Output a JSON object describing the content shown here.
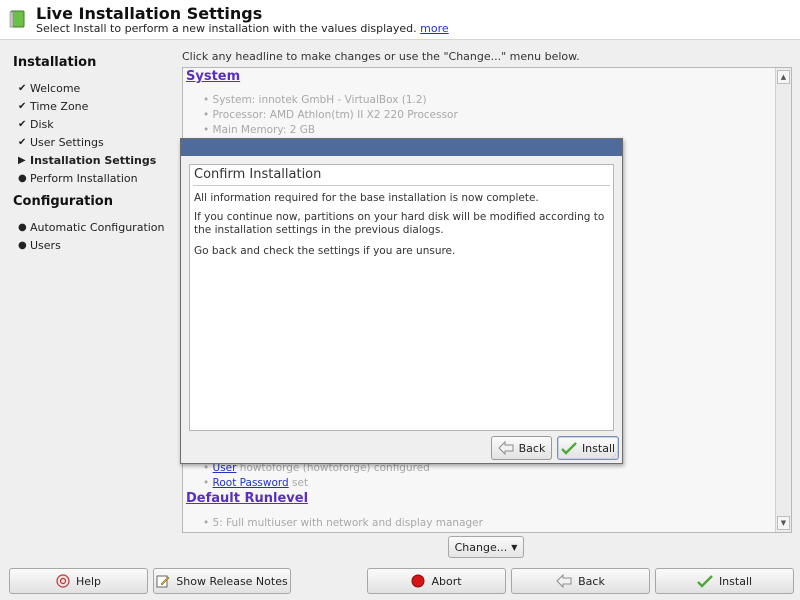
{
  "header": {
    "title": "Live Installation Settings",
    "subtitle": "Select Install to perform a new installation with the values displayed.",
    "more_link": "more"
  },
  "sidebar": {
    "installation_title": "Installation",
    "installation_items": [
      {
        "label": "Welcome",
        "state": "done"
      },
      {
        "label": "Time Zone",
        "state": "done"
      },
      {
        "label": "Disk",
        "state": "done"
      },
      {
        "label": "User Settings",
        "state": "done"
      },
      {
        "label": "Installation Settings",
        "state": "current"
      },
      {
        "label": "Perform Installation",
        "state": "todo"
      }
    ],
    "configuration_title": "Configuration",
    "configuration_items": [
      {
        "label": "Automatic Configuration",
        "state": "todo"
      },
      {
        "label": "Users",
        "state": "todo"
      }
    ]
  },
  "main": {
    "instruction": "Click any headline to make changes or use the \"Change...\" menu below.",
    "overview": {
      "system_heading": "System",
      "system_items": [
        "System: innotek GmbH - VirtualBox (1.2)",
        "Processor: AMD Athlon(tm) II X2 220 Processor",
        "Main Memory: 2 GB"
      ],
      "user_link": "User",
      "user_rest": " howtoforge (howtoforge) configured",
      "root_link": "Root Password",
      "root_rest": " set",
      "runlevel_heading": "Default Runlevel",
      "runlevel_item": "5: Full multiuser with network and display manager"
    },
    "change_label": "Change..."
  },
  "dialog": {
    "title": "Confirm Installation",
    "line1": "All information required for the base installation is now complete.",
    "line2": "If you continue now, partitions on your hard disk will be modified according to the installation settings in the previous dialogs.",
    "line3": "Go back and check the settings if you are unsure.",
    "back_label": "Back",
    "install_label": "Install"
  },
  "buttons": {
    "help": "Help",
    "release_notes": "Show Release Notes",
    "abort": "Abort",
    "back": "Back",
    "install": "Install"
  },
  "colors": {
    "dialog_titlebar": "#4e6b9c",
    "link_purple": "#5a2fbf",
    "link_blue": "#2033c6",
    "abort_red": "#d31515",
    "check_green": "#4fa83a"
  }
}
